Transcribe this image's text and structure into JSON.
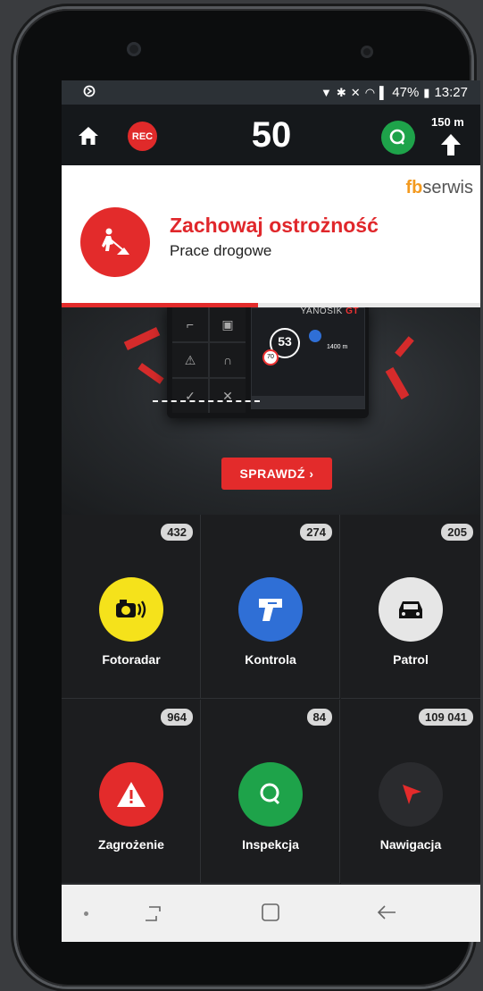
{
  "status_bar": {
    "battery": "47%",
    "time": "13:27"
  },
  "top_bar": {
    "rec_label": "REC",
    "speed": "50",
    "distance": "150 m"
  },
  "alert": {
    "title": "Zachowaj ostrożność",
    "subtitle": "Prace drogowe",
    "brand_fb": "fb",
    "brand_rest": "serwis",
    "progress": 0.47
  },
  "promo": {
    "device_brand": "YANOSIK",
    "device_model": "GT",
    "device_speed": "53",
    "device_limit": "70",
    "device_distance": "1400 m",
    "button_label": "SPRAWDŹ"
  },
  "categories": [
    {
      "label": "Fotoradar",
      "count": "432",
      "color": "#f5e21b",
      "icon": "speed-camera-icon"
    },
    {
      "label": "Kontrola",
      "count": "274",
      "color": "#2f6fd6",
      "icon": "radar-gun-icon"
    },
    {
      "label": "Patrol",
      "count": "205",
      "color": "#e6e6e6",
      "icon": "police-car-icon"
    },
    {
      "label": "Zagrożenie",
      "count": "964",
      "color": "#e32b2b",
      "icon": "warning-triangle-icon"
    },
    {
      "label": "Inspekcja",
      "count": "84",
      "color": "#1ea34a",
      "icon": "inspection-icon"
    },
    {
      "label": "Nawigacja",
      "count": "109 041",
      "color": "#2a2b2e",
      "icon": "navigation-arrow-icon"
    }
  ]
}
